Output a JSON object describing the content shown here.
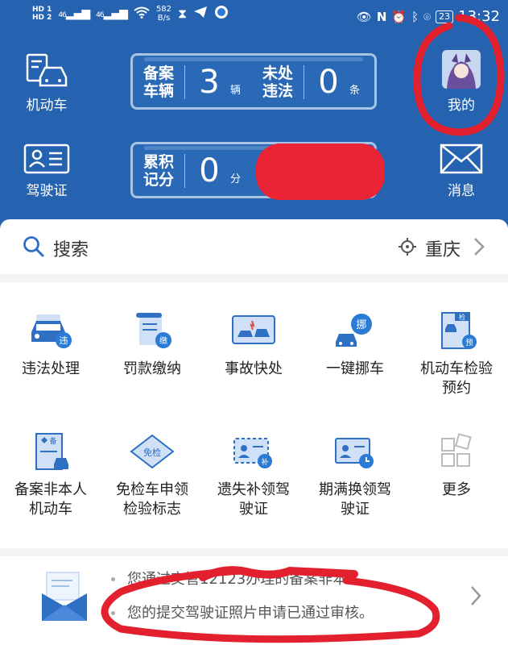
{
  "status_bar": {
    "network_badges": [
      "HD 1",
      "HD 2"
    ],
    "signal_labels": [
      "46",
      "46"
    ],
    "speed_value": "582",
    "speed_unit": "B/s",
    "battery": "23",
    "time": "13:32"
  },
  "header": {
    "vehicle_button": "机动车",
    "license_button": "驾驶证",
    "mine_button": "我的",
    "message_button": "消息",
    "stats_top": {
      "registered_label": "备案\n车辆",
      "registered_count": "3",
      "registered_unit": "辆",
      "violations_label": "未处\n违法",
      "violations_count": "0",
      "violations_unit": "条"
    },
    "stats_bottom": {
      "points_label": "累积\n记分",
      "points_count": "0",
      "points_unit": "分"
    }
  },
  "search": {
    "label": "搜索",
    "city": "重庆"
  },
  "services": [
    {
      "label": "违法处理",
      "icon": "violation-car-icon"
    },
    {
      "label": "罚款缴纳",
      "icon": "fine-payment-icon"
    },
    {
      "label": "事故快处",
      "icon": "accident-icon"
    },
    {
      "label": "一键挪车",
      "icon": "move-car-icon"
    },
    {
      "label": "机动车检验预约",
      "icon": "inspection-booking-icon"
    },
    {
      "label": "备案非本人机动车",
      "icon": "register-vehicle-icon"
    },
    {
      "label": "免检车申领检验标志",
      "icon": "exempt-label-icon"
    },
    {
      "label": "遗失补领驾驶证",
      "icon": "reissue-license-icon"
    },
    {
      "label": "期满换领驾驶证",
      "icon": "renew-license-icon"
    },
    {
      "label": "更多",
      "icon": "more-grid-icon"
    }
  ],
  "notifications": [
    "您通过交管12123办理的备案非本人...",
    "您的提交驾驶证照片申请已通过审核。"
  ],
  "colors": {
    "header_bg": "#2563b0",
    "accent_blue": "#2f6fc4",
    "annotation_red": "#e3202e"
  }
}
